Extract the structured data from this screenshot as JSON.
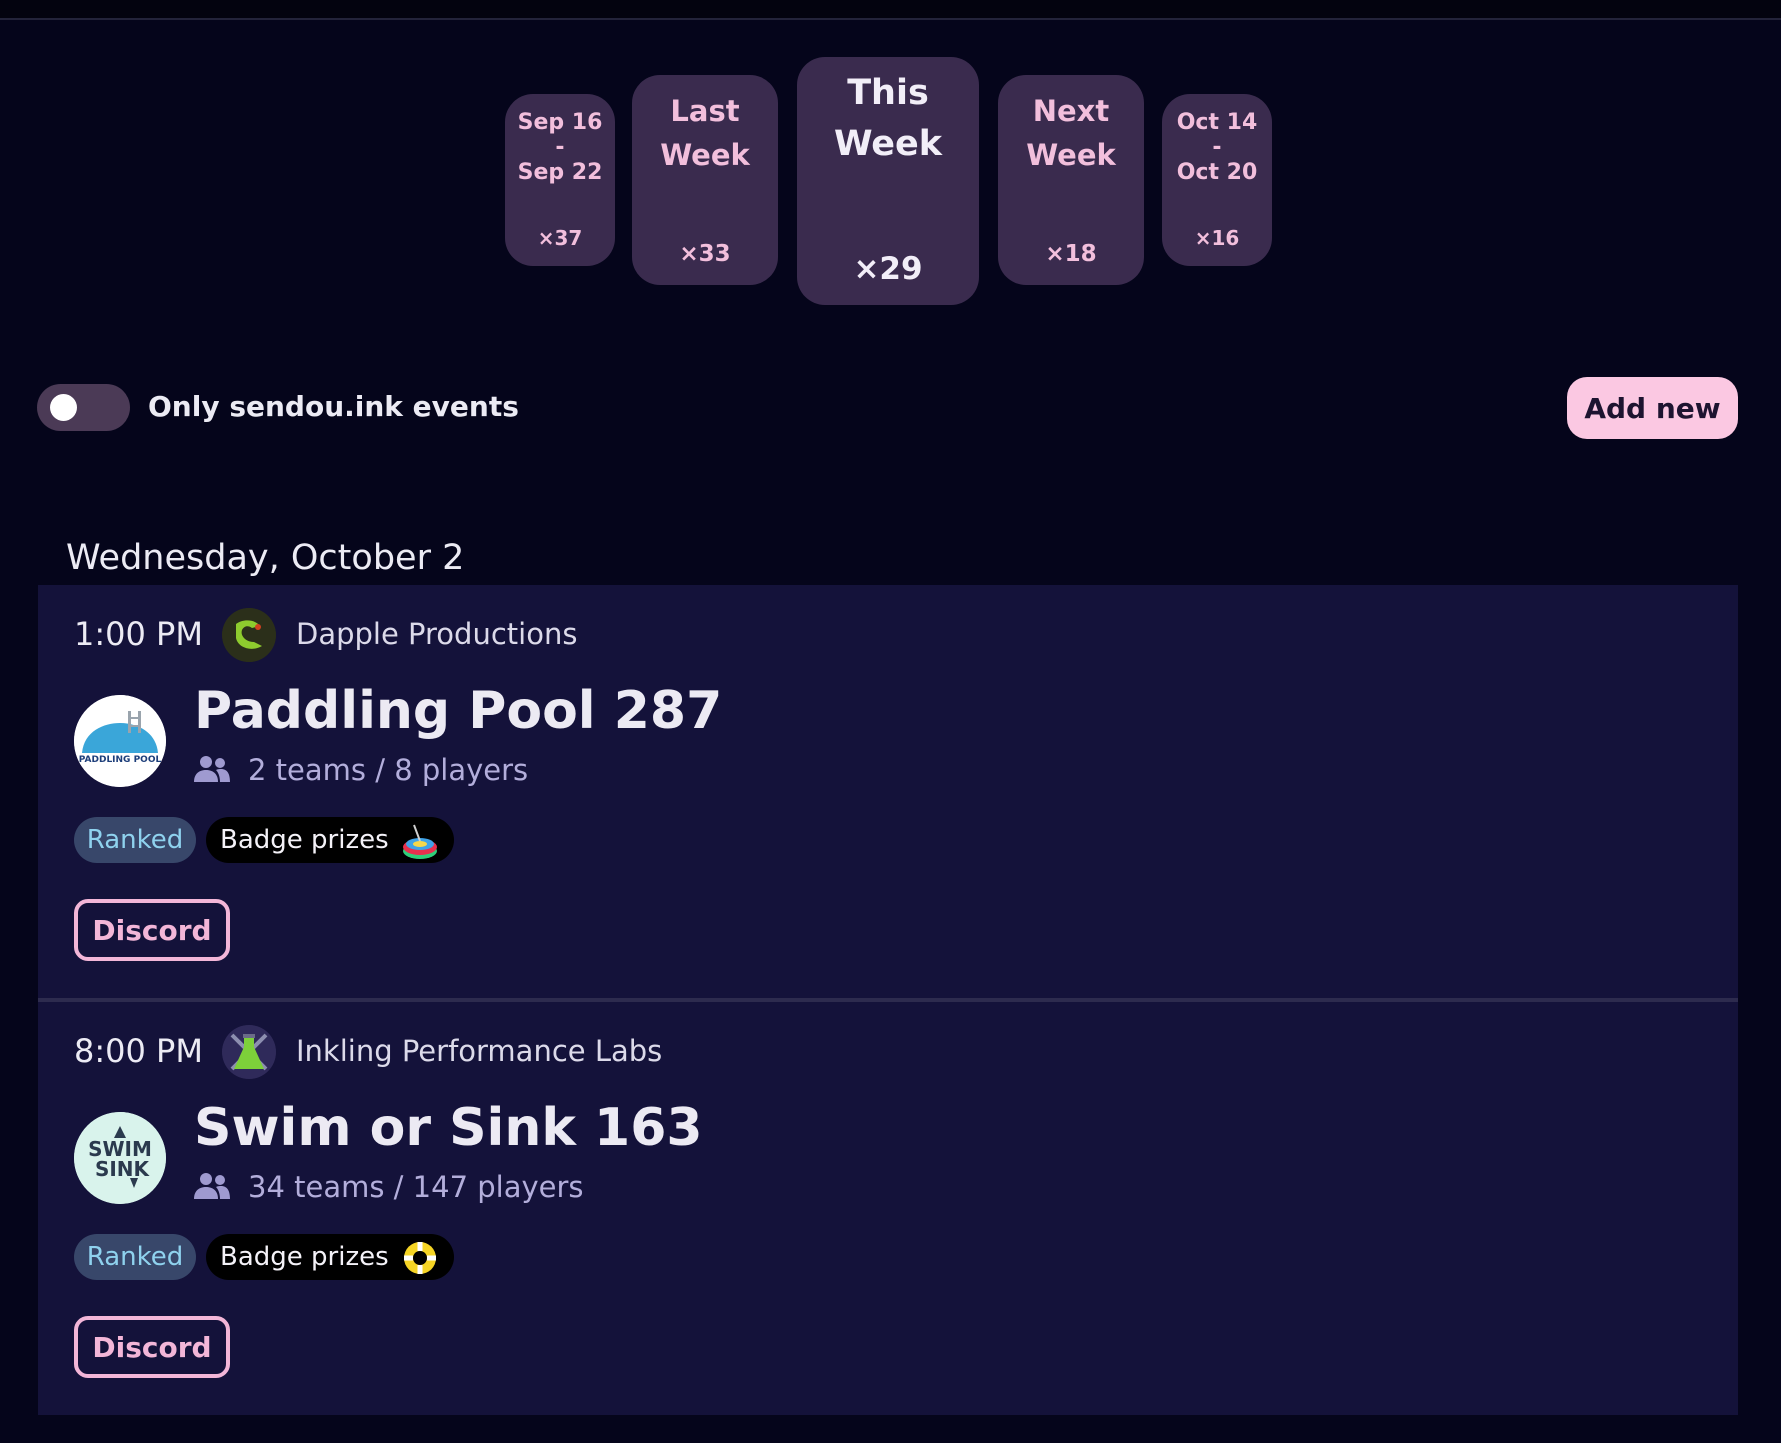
{
  "weeks": [
    {
      "label": "Sep 16\n-\nSep 22",
      "count": "×37"
    },
    {
      "label": "Last\nWeek",
      "count": "×33"
    },
    {
      "label": "This\nWeek",
      "count": "×29"
    },
    {
      "label": "Next\nWeek",
      "count": "×18"
    },
    {
      "label": "Oct 14\n-\nOct 20",
      "count": "×16"
    }
  ],
  "filter": {
    "toggle_label": "Only sendou.ink events",
    "toggle_on": false
  },
  "add_new_label": "Add new",
  "day_heading": "Wednesday, October 2",
  "events": [
    {
      "time": "1:00 PM",
      "organizer": "Dapple Productions",
      "organizer_icon": "dapple-productions-logo",
      "title": "Paddling Pool 287",
      "logo_text": "PADDLING POOL",
      "stats": "2 teams / 8 players",
      "tag_ranked": "Ranked",
      "tag_badge": "Badge prizes",
      "badge_icon": "pool-float-badge",
      "discord_label": "Discord"
    },
    {
      "time": "8:00 PM",
      "organizer": "Inkling Performance Labs",
      "organizer_icon": "inkling-labs-flask-logo",
      "title": "Swim or Sink 163",
      "logo_text": "SWIM SINK",
      "stats": "34 teams / 147 players",
      "tag_ranked": "Ranked",
      "tag_badge": "Badge prizes",
      "badge_icon": "life-ring-badge",
      "discord_label": "Discord"
    }
  ]
}
